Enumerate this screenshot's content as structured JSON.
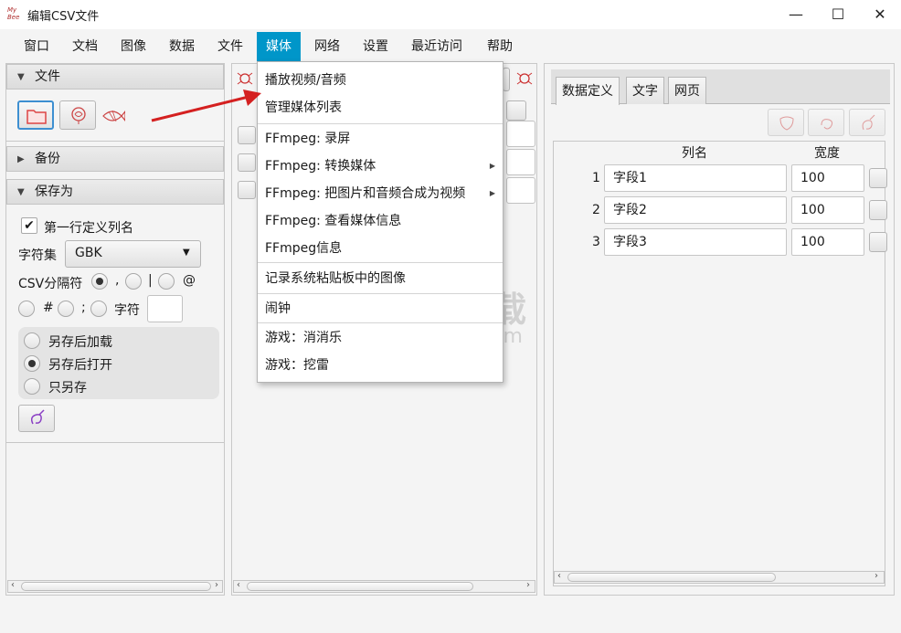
{
  "window": {
    "icon_text": "My Bee",
    "title": "编辑CSV文件",
    "minimize": "—",
    "maximize": "☐",
    "close": "✕"
  },
  "menubar": [
    "窗口",
    "文档",
    "图像",
    "数据",
    "文件",
    "媒体",
    "网络",
    "设置",
    "最近访问",
    "帮助"
  ],
  "active_menu": "媒体",
  "left_panel": {
    "file_section": "文件",
    "backup_section": "备份",
    "saveas_section": "保存为",
    "first_row_label": "第一行定义列名",
    "first_row_checked": true,
    "charset_label": "字符集",
    "charset_value": "GBK",
    "csv_sep_label": "CSV分隔符",
    "sep_opt1": ",",
    "sep_opt2": "|",
    "sep_opt3": "@",
    "sep_opt4": "#",
    "sep_opt5": ";",
    "sep_opt6": "字符",
    "after_save_options": [
      "另存后加载",
      "另存后打开",
      "只另存"
    ],
    "after_save_selected": 1
  },
  "dropdown": {
    "items": [
      {
        "label": "播放视频/音频",
        "submenu": false
      },
      {
        "label": "管理媒体列表",
        "submenu": false
      },
      {
        "label": "FFmpeg: 录屏",
        "submenu": false
      },
      {
        "label": "FFmpeg: 转换媒体",
        "submenu": true
      },
      {
        "label": "FFmpeg: 把图片和音频合成为视频",
        "submenu": true
      },
      {
        "label": "FFmpeg: 查看媒体信息",
        "submenu": false
      },
      {
        "label": "FFmpeg信息",
        "submenu": false
      },
      {
        "label": "记录系统粘贴板中的图像",
        "submenu": false
      },
      {
        "label": "闹钟",
        "submenu": false
      },
      {
        "label": "游戏：消消乐",
        "submenu": false
      },
      {
        "label": "游戏：挖雷",
        "submenu": false
      }
    ]
  },
  "right_panel": {
    "tabs": [
      "数据定义",
      "文字",
      "网页"
    ],
    "selected_tab": 0,
    "header_col_name": "列名",
    "header_width": "宽度",
    "rows": [
      {
        "index": "1",
        "name": "字段1",
        "width": "100"
      },
      {
        "index": "2",
        "name": "字段2",
        "width": "100"
      },
      {
        "index": "3",
        "name": "字段3",
        "width": "100"
      }
    ]
  },
  "watermark": {
    "cn": "安下载",
    "en": "anxz.com"
  },
  "colors": {
    "menu_active_bg": "#0096c9",
    "arrow": "#d42020"
  }
}
